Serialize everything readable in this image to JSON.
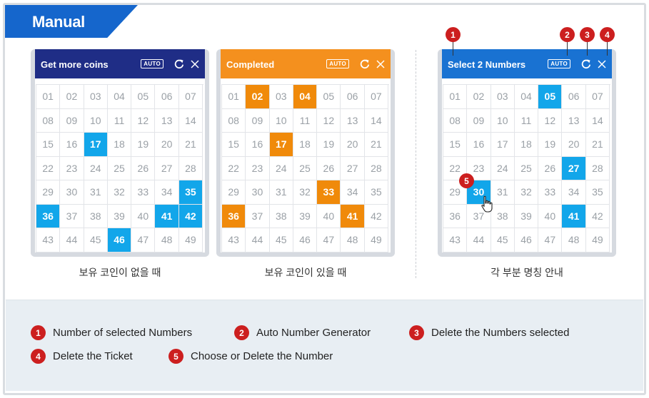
{
  "tab_title": "Manual",
  "cards": [
    {
      "title": "Get more coins",
      "header_color": "#1f2d86",
      "selected_color": "#12a6ea",
      "auto_label": "AUTO",
      "caption": "보유 코인이 없을 때",
      "numbers": [
        "01",
        "02",
        "03",
        "04",
        "05",
        "06",
        "07",
        "08",
        "09",
        "10",
        "11",
        "12",
        "13",
        "14",
        "15",
        "16",
        "17",
        "18",
        "19",
        "20",
        "21",
        "22",
        "23",
        "24",
        "25",
        "26",
        "27",
        "28",
        "29",
        "30",
        "31",
        "32",
        "33",
        "34",
        "35",
        "36",
        "37",
        "38",
        "39",
        "40",
        "41",
        "42",
        "43",
        "44",
        "45",
        "46",
        "47",
        "48",
        "49"
      ],
      "selected": [
        "17",
        "35",
        "36",
        "41",
        "42",
        "46"
      ]
    },
    {
      "title": "Completed",
      "header_color": "#f4901e",
      "selected_color": "#f08a0a",
      "auto_label": "AUTO",
      "caption": "보유 코인이 있을 때",
      "numbers": [
        "01",
        "02",
        "03",
        "04",
        "05",
        "06",
        "07",
        "08",
        "09",
        "10",
        "11",
        "12",
        "13",
        "14",
        "15",
        "16",
        "17",
        "18",
        "19",
        "20",
        "21",
        "22",
        "23",
        "24",
        "25",
        "26",
        "27",
        "28",
        "29",
        "30",
        "31",
        "32",
        "33",
        "34",
        "35",
        "36",
        "37",
        "38",
        "39",
        "40",
        "41",
        "42",
        "43",
        "44",
        "45",
        "46",
        "47",
        "48",
        "49"
      ],
      "selected": [
        "02",
        "04",
        "17",
        "33",
        "36",
        "41"
      ]
    },
    {
      "title": "Select 2 Numbers",
      "header_color": "#1972d2",
      "selected_color": "#12a6ea",
      "auto_label": "AUTO",
      "caption": "각 부분 명칭 안내",
      "numbers": [
        "01",
        "02",
        "03",
        "04",
        "05",
        "06",
        "07",
        "08",
        "09",
        "10",
        "11",
        "12",
        "13",
        "14",
        "15",
        "16",
        "17",
        "18",
        "19",
        "20",
        "21",
        "22",
        "23",
        "24",
        "25",
        "26",
        "27",
        "28",
        "29",
        "30",
        "31",
        "32",
        "33",
        "34",
        "35",
        "36",
        "37",
        "38",
        "39",
        "40",
        "41",
        "42",
        "43",
        "44",
        "45",
        "46",
        "47",
        "48",
        "49"
      ],
      "selected": [
        "05",
        "27",
        "30",
        "41"
      ]
    }
  ],
  "markers": [
    "1",
    "2",
    "3",
    "4",
    "5"
  ],
  "legend": [
    {
      "num": "1",
      "label": "Number of selected Numbers"
    },
    {
      "num": "2",
      "label": "Auto Number Generator"
    },
    {
      "num": "3",
      "label": "Delete the Numbers selected"
    },
    {
      "num": "4",
      "label": "Delete the Ticket"
    },
    {
      "num": "5",
      "label": "Choose or Delete the Number"
    }
  ],
  "colors": {
    "tab": "#1566cc",
    "marker": "#cc1f1f",
    "legend_bg": "#e8eef3"
  },
  "icons": [
    "refresh-icon",
    "close-icon",
    "hand-pointer-icon"
  ]
}
